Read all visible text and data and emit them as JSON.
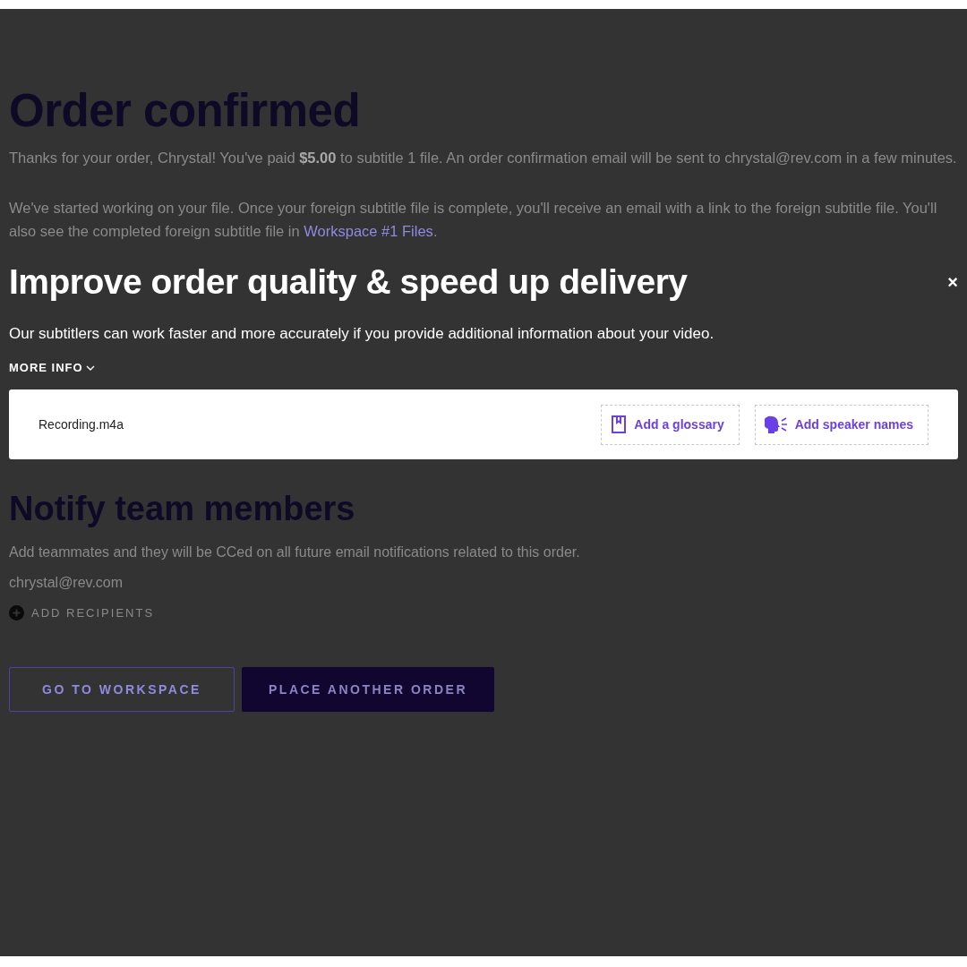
{
  "page": {
    "title": "Order confirmed",
    "paragraphs": [
      "Thanks for your order, Chrystal!  You've paid **$5.00** to subtitle 1 file. An order confirmation email will be sent to chrystal@rev.com in a few minutes."
    ],
    "files_note": {
      "before": "We've started working on your file. Once your foreign subtitle file is complete, you'll receive an email with a link to the foreign subtitle file. You'll also see the completed foreign subtitle file in ",
      "link": "Workspace #1 Files",
      "after": "."
    },
    "notify": {
      "title": "Notify team members",
      "description": "Add teammates and they will be CCed on all future email notifications related to this order.",
      "recipients": [
        "chrystal@rev.com"
      ],
      "add_label": "ADD RECIPIENTS"
    },
    "buttons": [
      {
        "label": "GO TO WORKSPACE",
        "kind": "outline"
      },
      {
        "label": "PLACE ANOTHER ORDER",
        "kind": "filled"
      }
    ]
  },
  "modal": {
    "title": "Improve order quality & speed up delivery",
    "close": "×",
    "description": "Our subtitlers can work faster and more accurately if you provide additional information about your video.",
    "more_info": {
      "label": "MORE INFO",
      "expanded": false
    },
    "files": [
      {
        "name": "Recording.m4a",
        "actions": [
          {
            "label": "Add a glossary",
            "kind": "glossary"
          },
          {
            "label": "Add speaker names",
            "kind": "speakers"
          }
        ]
      }
    ]
  }
}
